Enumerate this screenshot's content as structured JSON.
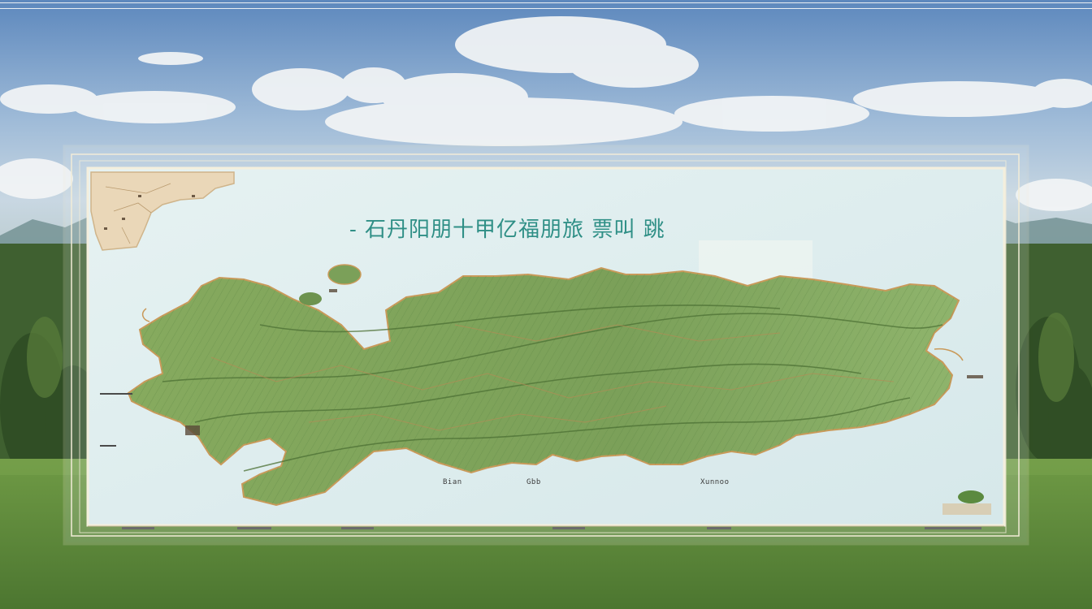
{
  "title": "- 石丹阳朋十甲亿福朋旅 票叫 跳",
  "colors": {
    "sky_top": "#6f96c6",
    "sky_mid": "#a9c3de",
    "grass": "#5f8a3a",
    "forest": "#3e5c2e",
    "panel": "#dfeef0",
    "frame": "#f2ecd8",
    "land": "#7ea35a",
    "land_dark": "#5f8a45",
    "coast": "#c9a066",
    "title_text": "#2f8f86"
  },
  "icons": [
    "map-inset",
    "land-mass",
    "cloud",
    "tree"
  ],
  "place_labels": {
    "south_a": "Bian",
    "south_b": "Gbb",
    "south_c": "Xunnoo"
  }
}
